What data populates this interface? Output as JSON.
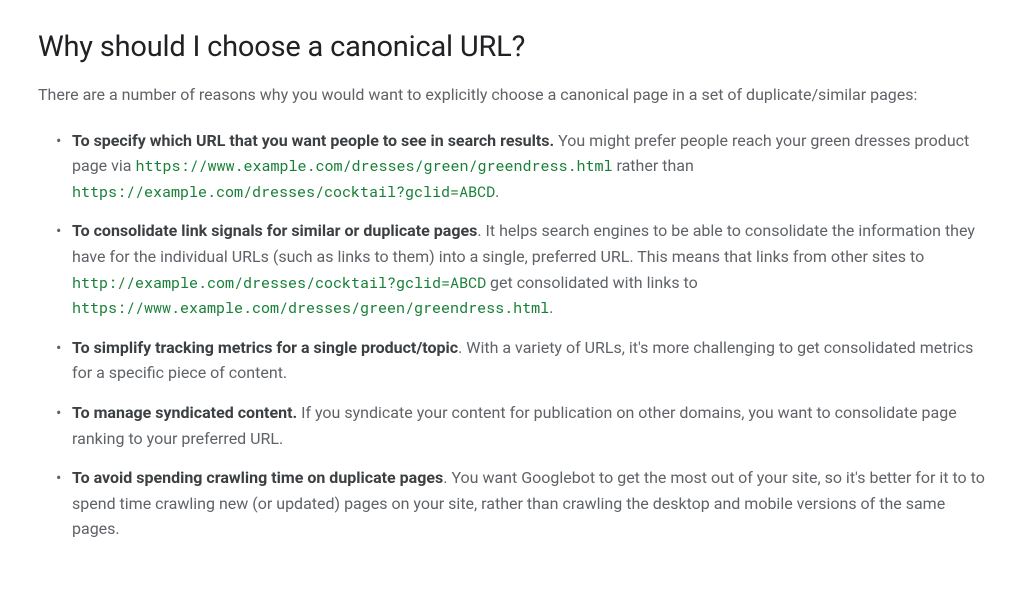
{
  "heading": "Why should I choose a canonical URL?",
  "intro": "There are a number of reasons why you would want to explicitly choose a canonical page in a set of duplicate/similar pages:",
  "items": [
    {
      "bold": "To specify which URL that you want people to see in search results.",
      "text1": " You might prefer people reach your green dresses product page via ",
      "code1": "https://www.example.com/dresses/green/greendress.html",
      "text2": " rather than ",
      "code2": "https://example.com/dresses/cocktail?gclid=ABCD",
      "text3": "."
    },
    {
      "bold": "To consolidate link signals for similar or duplicate pages",
      "text1": ". It helps search engines to be able to consolidate the information they have for the individual URLs (such as links to them) into a single, preferred URL. This means that links from other sites to ",
      "code1": "http://example.com/dresses/cocktail?gclid=ABCD",
      "text2": " get consolidated with links to ",
      "code2": "https://www.example.com/dresses/green/greendress.html",
      "text3": "."
    },
    {
      "bold": "To simplify tracking metrics for a single product/topic",
      "text1": ". With a variety of URLs, it's more challenging to get consolidated metrics for a specific piece of content."
    },
    {
      "bold": "To manage syndicated content.",
      "text1": " If you syndicate your content for publication on other domains, you want to consolidate page ranking to your preferred URL."
    },
    {
      "bold": "To avoid spending crawling time on duplicate pages",
      "text1": ". You want Googlebot to get the most out of your site, so it's better for it to to spend time crawling new (or updated) pages on your site, rather than crawling the desktop and mobile versions of the same pages."
    }
  ]
}
